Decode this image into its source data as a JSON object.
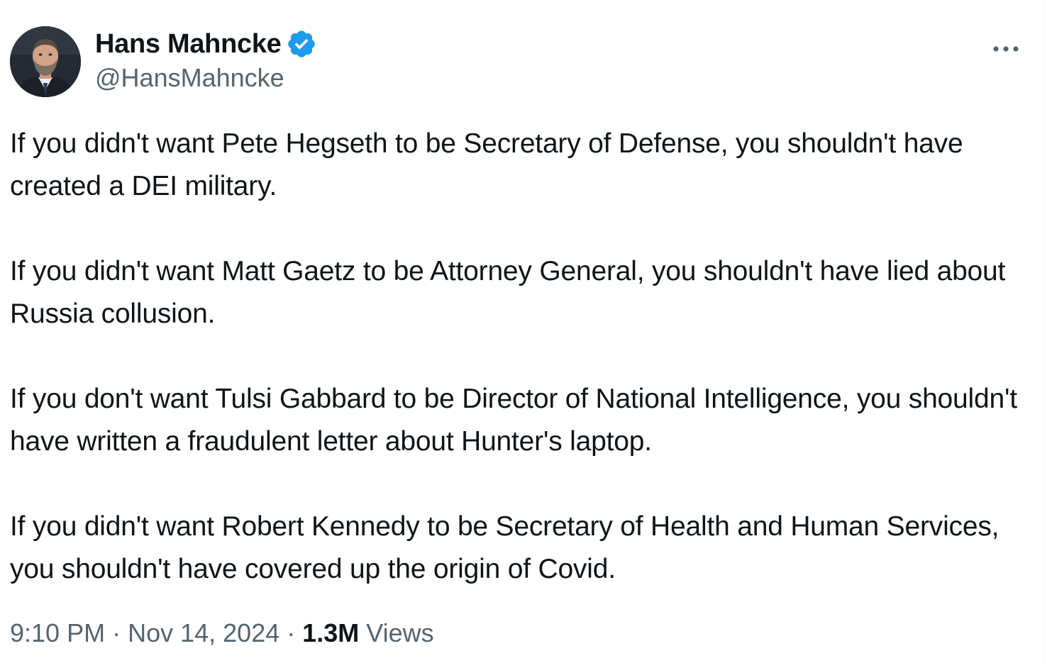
{
  "author": {
    "display_name": "Hans Mahncke",
    "handle": "@HansMahncke",
    "verified_icon": "verified-badge-icon",
    "verified_color": "#1d9bf0"
  },
  "more_icon": "more-options-icon",
  "tweet": {
    "paragraphs": [
      "If you didn't want Pete Hegseth to be Secretary of Defense, you shouldn't have created a DEI military.",
      "If you didn't want Matt Gaetz to be Attorney General, you shouldn't have lied about Russia collusion.",
      "If you don't want Tulsi Gabbard to be Director of National Intelligence, you shouldn't have written a fraudulent letter about Hunter's laptop.",
      "If you didn't want Robert Kennedy to be Secretary of Health and Human Services, you shouldn't have covered up the origin of Covid."
    ]
  },
  "meta": {
    "time": "9:10 PM",
    "separator": " · ",
    "date": "Nov 14, 2024",
    "views_count": "1.3M",
    "views_label": "Views"
  },
  "colors": {
    "text": "#0f1419",
    "secondary": "#536471",
    "accent": "#1d9bf0"
  }
}
